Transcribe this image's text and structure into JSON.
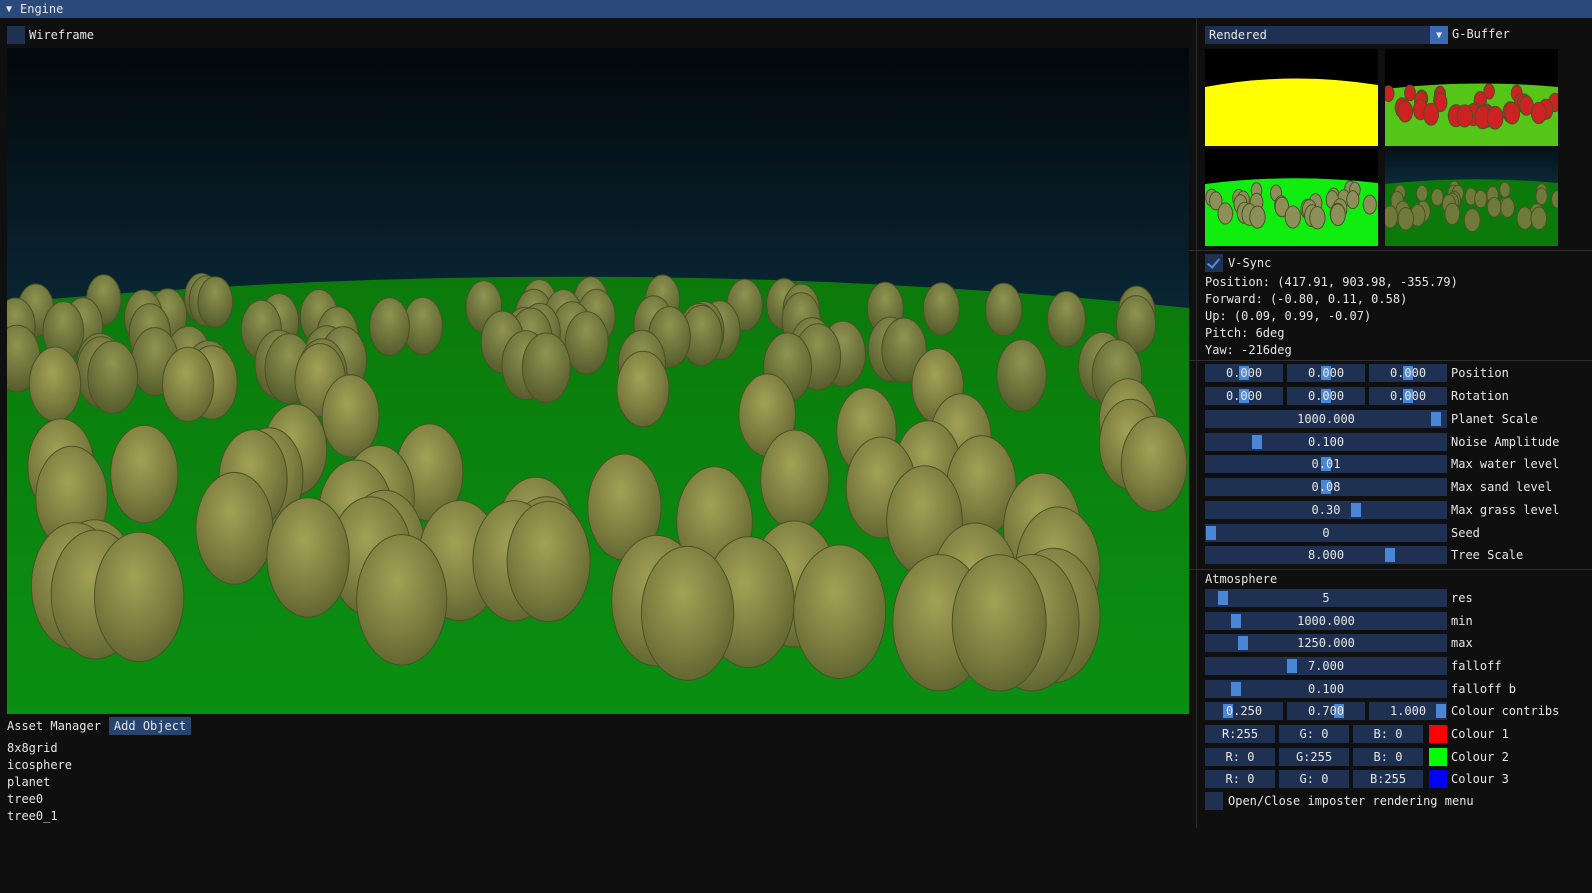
{
  "window": {
    "title": "Engine"
  },
  "toolbar": {
    "wireframe_label": "Wireframe"
  },
  "assets": {
    "title": "Asset Manager",
    "add_label": "Add Object",
    "items": [
      "8x8grid",
      "icosphere",
      "planet",
      "tree0",
      "tree0_1"
    ]
  },
  "render": {
    "mode": "Rendered",
    "gbuffer_label": "G-Buffer"
  },
  "camera": {
    "vsync_label": "V-Sync",
    "position": "Position: (417.91, 903.98, -355.79)",
    "forward": "Forward: (-0.80, 0.11, 0.58)",
    "up": "Up: (0.09, 0.99, -0.07)",
    "pitch": "Pitch: 6deg",
    "yaw": "Yaw: -216deg"
  },
  "transform": {
    "position": {
      "label": "Position",
      "values": [
        "0.000",
        "0.000",
        "0.000"
      ]
    },
    "rotation": {
      "label": "Rotation",
      "values": [
        "0.000",
        "0.000",
        "0.000"
      ]
    }
  },
  "params": [
    {
      "label": "Planet Scale",
      "value": "1000.000",
      "level": 0.98
    },
    {
      "label": "Noise Amplitude",
      "value": "0.100",
      "level": 0.2
    },
    {
      "label": "Max water level",
      "value": "0.01",
      "level": 0.5
    },
    {
      "label": "Max sand level",
      "value": "0.08",
      "level": 0.5
    },
    {
      "label": "Max grass level",
      "value": "0.30",
      "level": 0.63
    },
    {
      "label": "Seed",
      "value": "0",
      "level": 0.0
    },
    {
      "label": "Tree Scale",
      "value": "8.000",
      "level": 0.78
    }
  ],
  "atmosphere": {
    "title": "Atmosphere",
    "params": [
      {
        "label": "res",
        "value": "5",
        "level": 0.05
      },
      {
        "label": "min",
        "value": "1000.000",
        "level": 0.11
      },
      {
        "label": "max",
        "value": "1250.000",
        "level": 0.14
      },
      {
        "label": "falloff",
        "value": "7.000",
        "level": 0.35
      },
      {
        "label": "falloff b",
        "value": "0.100",
        "level": 0.11
      }
    ],
    "colour_contribs": {
      "label": "Colour contribs",
      "values": [
        "0.250",
        "0.700",
        "1.000"
      ],
      "levels": [
        0.25,
        0.7,
        1.0
      ]
    },
    "colours": [
      {
        "label": "Colour 1",
        "r": "R:255",
        "g": "G:  0",
        "b": "B:  0",
        "hex": "#ff0000"
      },
      {
        "label": "Colour 2",
        "r": "R:  0",
        "g": "G:255",
        "b": "B:  0",
        "hex": "#00ff00"
      },
      {
        "label": "Colour 3",
        "r": "R:  0",
        "g": "G:  0",
        "b": "B:255",
        "hex": "#0000ff"
      }
    ],
    "imposter_label": "Open/Close imposter rendering menu"
  },
  "colors": {
    "title_bar": "#294a7a",
    "frame_bg": "#1f3152",
    "grab": "#4a86d6",
    "check": "#4d8fe0"
  }
}
